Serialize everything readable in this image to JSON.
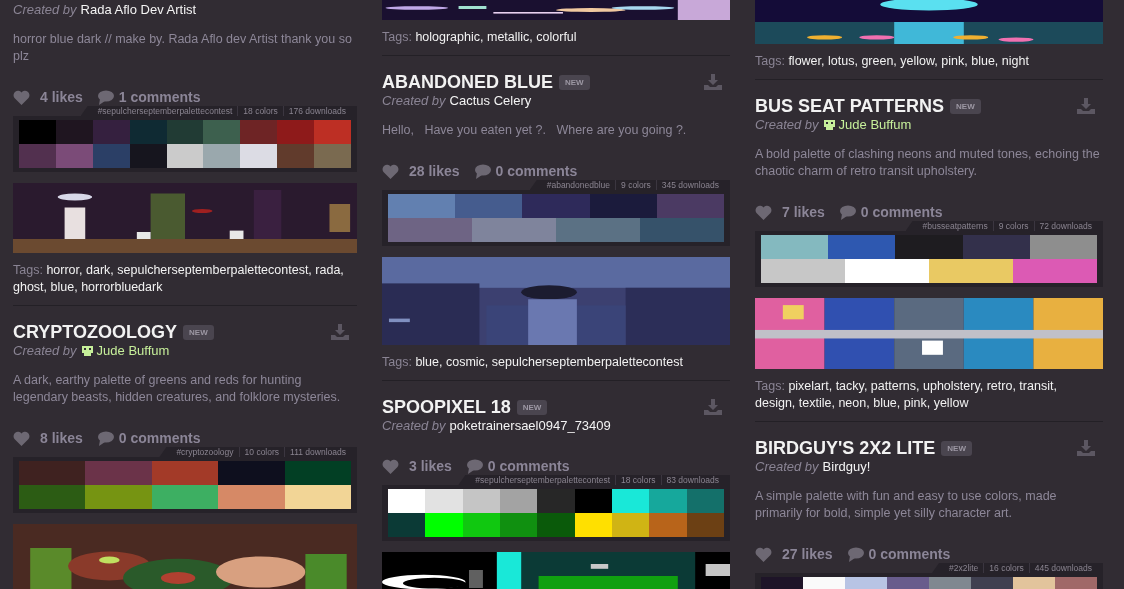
{
  "columns": [
    {
      "blocks": [
        {
          "kind": "card",
          "creator_label": "Created by",
          "creator": {
            "name": "Rada Aflo Dev Artist",
            "highlighted": false
          },
          "description": "horror blue dark // make by. Rada Aflo dev Artist thank you so plz",
          "likes": "4 likes",
          "comments": "1 comments",
          "meta": [
            "#sepulcherseptemberpalettecontest",
            "18 colors",
            "176 downloads"
          ],
          "swatch_rows": [
            [
              {
                "color": "#000000"
              },
              {
                "color": "#1f1520"
              },
              {
                "color": "#35203f"
              },
              {
                "color": "#0f2a33"
              },
              {
                "color": "#213b34"
              },
              {
                "color": "#3d604e"
              },
              {
                "color": "#6e2425"
              },
              {
                "color": "#8e1a1a"
              },
              {
                "color": "#bd2f24"
              }
            ],
            [
              {
                "color": "#52304f"
              },
              {
                "color": "#7b4b78"
              },
              {
                "color": "#2b3f66"
              },
              {
                "color": "#16151e"
              },
              {
                "color": "#cbcbcb"
              },
              {
                "color": "#9aa8ad"
              },
              {
                "color": "#dcdce4"
              },
              {
                "color": "#613b2c"
              },
              {
                "color": "#7a6a50"
              }
            ]
          ]
        },
        {
          "kind": "picture"
        },
        {
          "kind": "tags",
          "label": "Tags:",
          "tags": [
            "horror,",
            "dark,",
            "sepulcherseptemberpalettecontest,",
            "rada,",
            "ghost,",
            "blue,",
            "horrorbluedark"
          ]
        },
        {
          "kind": "card",
          "title": "CRYPTOZOOLOGY",
          "badge": "NEW",
          "creator_label": "Created by",
          "creator": {
            "name": "Jude Buffum",
            "highlighted": true
          },
          "description": "A dark, earthy palette of greens and reds for hunting legendary beasts, hidden creatures, and folklore mysteries.",
          "likes": "8 likes",
          "comments": "0 comments",
          "meta": [
            "#cryptozoology",
            "10 colors",
            "111 downloads"
          ],
          "swatch_rows": [
            [
              {
                "color": "#3f2220"
              },
              {
                "color": "#6b3349"
              },
              {
                "color": "#a33a28"
              },
              {
                "color": "#0e0f1e"
              },
              {
                "color": "#023f24"
              }
            ],
            [
              {
                "color": "#2c5c14"
              },
              {
                "color": "#769412"
              },
              {
                "color": "#3daf62"
              },
              {
                "color": "#d68966"
              },
              {
                "color": "#f2d596"
              }
            ]
          ]
        },
        {
          "kind": "picture"
        }
      ]
    },
    {
      "blocks": [
        {
          "kind": "picture"
        },
        {
          "kind": "tags",
          "label": "Tags:",
          "tags": [
            "holographic,",
            "metallic,",
            "colorful"
          ]
        },
        {
          "kind": "card",
          "title": "ABANDONED BLUE",
          "badge": "NEW",
          "creator_label": "Created by",
          "creator": {
            "name": "Cactus Celery",
            "highlighted": false
          },
          "description": "Hello,   Have you eaten yet ?.   Where are you going ?.",
          "likes": "28 likes",
          "comments": "0 comments",
          "meta": [
            "#abandonedblue",
            "9 colors",
            "345 downloads"
          ],
          "swatch_rows": [
            [
              {
                "color": "#6280b0"
              },
              {
                "color": "#455c8e"
              },
              {
                "color": "#2e2a5a"
              },
              {
                "color": "#1b1b3c"
              },
              {
                "color": "#4b3a63"
              }
            ],
            [
              {
                "color": "#6e6484"
              },
              {
                "color": "#7f849c"
              },
              {
                "color": "#5b7184"
              },
              {
                "color": "#36526a"
              }
            ]
          ]
        },
        {
          "kind": "picture"
        },
        {
          "kind": "tags",
          "label": "Tags:",
          "tags": [
            "blue,",
            "cosmic,",
            "sepulcherseptemberpalettecontest"
          ]
        },
        {
          "kind": "card",
          "title": "SPOOPIXEL 18",
          "badge": "NEW",
          "creator_label": "Created by",
          "creator": {
            "name": "poketrainersael0947_73409",
            "highlighted": false
          },
          "likes": "3 likes",
          "comments": "0 comments",
          "meta": [
            "#sepulcherseptemberpalettecontest",
            "18 colors",
            "83 downloads"
          ],
          "swatch_rows": [
            [
              {
                "color": "#ffffff"
              },
              {
                "color": "#e2e2e2"
              },
              {
                "color": "#c5c5c5"
              },
              {
                "color": "#a3a3a3"
              },
              {
                "color": "#272727"
              },
              {
                "color": "#000000"
              },
              {
                "color": "#19e8d8"
              },
              {
                "color": "#16a89c"
              },
              {
                "color": "#14706a"
              }
            ],
            [
              {
                "color": "#0b3a36"
              },
              {
                "color": "#00ff00"
              },
              {
                "color": "#10c810"
              },
              {
                "color": "#109010"
              },
              {
                "color": "#0a5a0a"
              },
              {
                "color": "#ffe000"
              },
              {
                "color": "#d0b414"
              },
              {
                "color": "#b8641a"
              },
              {
                "color": "#6c4014"
              }
            ]
          ]
        },
        {
          "kind": "picture"
        }
      ]
    },
    {
      "blocks": [
        {
          "kind": "picture"
        },
        {
          "kind": "tags",
          "label": "Tags:",
          "tags": [
            "flower,",
            "lotus,",
            "green,",
            "yellow,",
            "pink,",
            "blue,",
            "night"
          ]
        },
        {
          "kind": "card",
          "title": "BUS SEAT PATTERNS",
          "badge": "NEW",
          "creator_label": "Created by",
          "creator": {
            "name": "Jude Buffum",
            "highlighted": true
          },
          "description": "A bold palette of clashing neons and muted tones, echoing the chaotic charm of retro transit upholstery.",
          "likes": "7 likes",
          "comments": "0 comments",
          "meta": [
            "#busseatpatterns",
            "9 colors",
            "72 downloads"
          ],
          "swatch_rows": [
            [
              {
                "color": "#84b9bf"
              },
              {
                "color": "#2e58b0"
              },
              {
                "color": "#1e1c20"
              },
              {
                "color": "#33304b"
              },
              {
                "color": "#8e8e8e"
              }
            ],
            [
              {
                "color": "#c7c7c7"
              },
              {
                "color": "#ffffff"
              },
              {
                "color": "#e9c963"
              },
              {
                "color": "#dc5ab4"
              }
            ]
          ]
        },
        {
          "kind": "picture"
        },
        {
          "kind": "tags",
          "label": "Tags:",
          "tags": [
            "pixelart,",
            "tacky,",
            "patterns,",
            "upholstery,",
            "retro,",
            "transit,",
            "design,",
            "textile,",
            "neon,",
            "blue,",
            "pink,",
            "yellow"
          ]
        },
        {
          "kind": "card",
          "title": "BIRDGUY'S 2X2 LITE",
          "badge": "NEW",
          "creator_label": "Created by",
          "creator": {
            "name": "Birdguy!",
            "highlighted": false
          },
          "description": "A simple palette with fun and easy to use colors, made primarily for bold, simple yet silly character art.",
          "likes": "27 likes",
          "comments": "0 comments",
          "meta": [
            "#2x2lite",
            "16 colors",
            "445 downloads"
          ],
          "swatch_rows": [
            [
              {
                "color": "#1e1428"
              },
              {
                "color": "#fafafa"
              },
              {
                "color": "#b8c4e4"
              },
              {
                "color": "#685c8c"
              },
              {
                "color": "#808890"
              },
              {
                "color": "#404050"
              },
              {
                "color": "#e2c49c"
              },
              {
                "color": "#a06868"
              }
            ]
          ]
        }
      ]
    }
  ]
}
